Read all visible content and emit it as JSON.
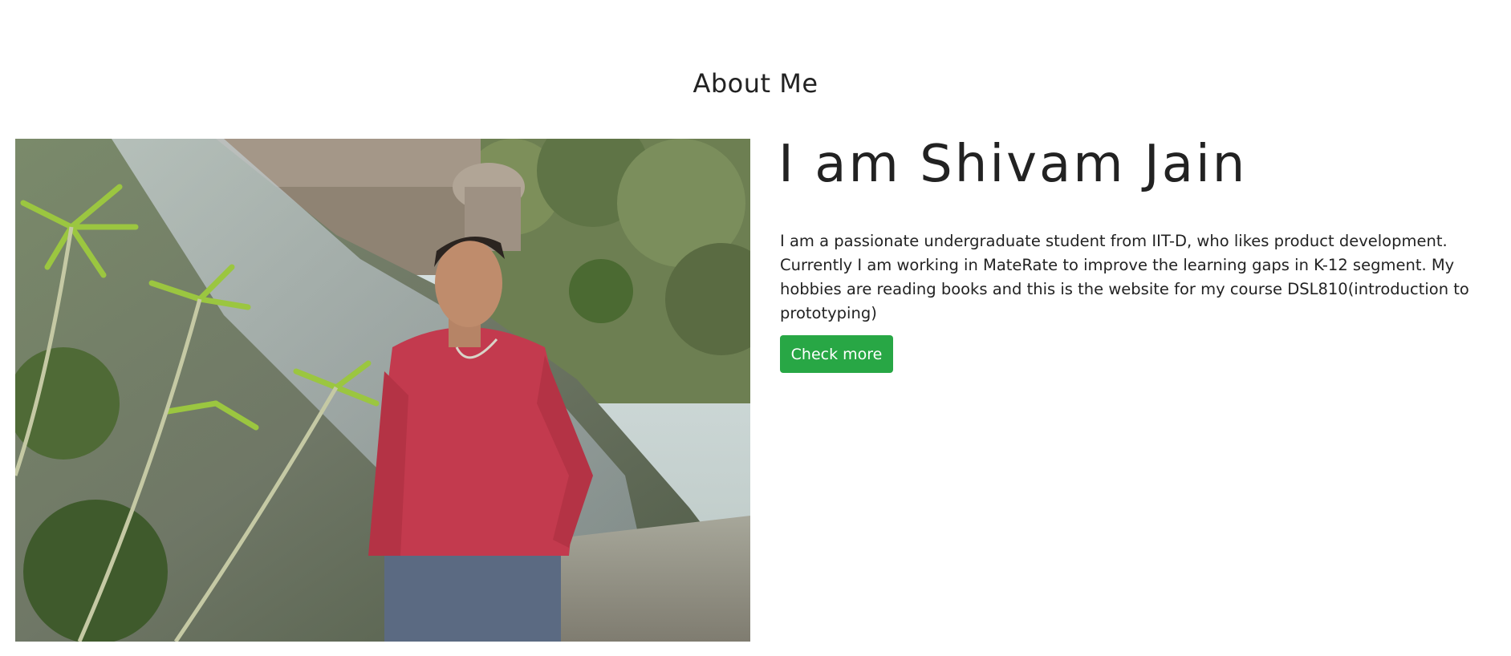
{
  "about": {
    "section_title": "About Me",
    "heading": "I am Shivam Jain",
    "description": "I am a passionate undergraduate student from IIT-D, who likes product development. Currently I am working in MateRate to improve the learning gaps in K-12 segment. My hobbies are reading books and this is the website for my course DSL810(introduction to prototyping)",
    "button_label": "Check more"
  },
  "colors": {
    "accent": "#28a745",
    "text": "#222222",
    "background": "#ffffff"
  }
}
